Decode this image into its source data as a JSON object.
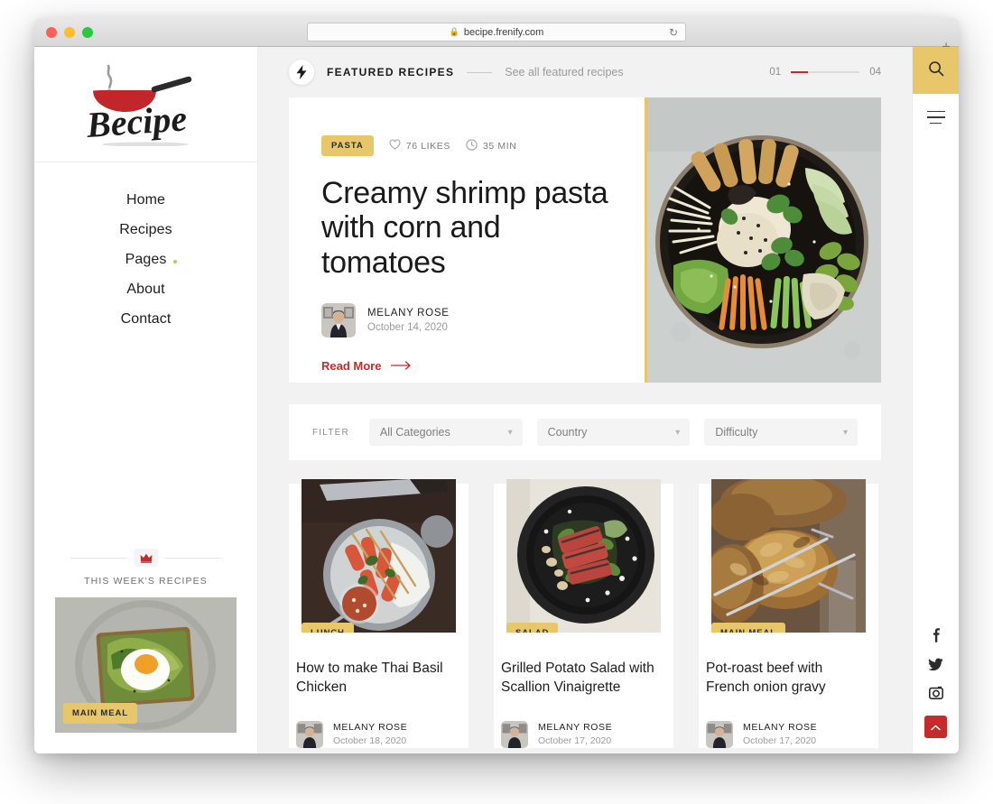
{
  "browser": {
    "url": "becipe.frenify.com",
    "lock_icon": "lock-icon",
    "reload_icon": "reload-icon",
    "newtab_label": "+"
  },
  "sidebar": {
    "logo_text": "Becipe",
    "nav": [
      {
        "label": "Home",
        "has_dot": false
      },
      {
        "label": "Recipes",
        "has_dot": false
      },
      {
        "label": "Pages",
        "has_dot": true
      },
      {
        "label": "About",
        "has_dot": false
      },
      {
        "label": "Contact",
        "has_dot": false
      }
    ],
    "week": {
      "crown_icon": "crown-icon",
      "title": "THIS WEEK'S RECIPES",
      "badge": "MAIN MEAL"
    }
  },
  "section": {
    "bolt_icon": "bolt-icon",
    "title": "FEATURED RECIPES",
    "link": "See all featured recipes",
    "slider_current": "01",
    "slider_total": "04",
    "slider_progress_pct": 25
  },
  "hero": {
    "category": "PASTA",
    "likes": "76 LIKES",
    "likes_icon": "heart-icon",
    "time": "35 MIN",
    "time_icon": "clock-icon",
    "title": "Creamy shrimp pasta with corn and tomatoes",
    "author": "MELANY ROSE",
    "date": "October 14, 2020",
    "read_more": "Read More",
    "read_more_icon": "arrow-right-icon"
  },
  "filter": {
    "label": "FILTER",
    "selects": [
      {
        "value": "All Categories",
        "icon": "chevron-down-icon"
      },
      {
        "value": "Country",
        "icon": "chevron-down-icon"
      },
      {
        "value": "Difficulty",
        "icon": "chevron-down-icon"
      }
    ]
  },
  "cards": [
    {
      "badge": "LUNCH",
      "title": "How to make Thai Basil Chicken",
      "author": "MELANY ROSE",
      "date": "October 18, 2020"
    },
    {
      "badge": "SALAD",
      "title": "Grilled Potato Salad with Scallion Vinaigrette",
      "author": "MELANY ROSE",
      "date": "October 17, 2020"
    },
    {
      "badge": "MAIN MEAL",
      "title": "Pot-roast beef with French onion gravy",
      "author": "MELANY ROSE",
      "date": "October 17, 2020"
    }
  ],
  "rail": {
    "search_icon": "search-icon",
    "menu_icon": "hamburger-menu-icon",
    "socials": [
      {
        "icon": "facebook-icon"
      },
      {
        "icon": "twitter-icon"
      },
      {
        "icon": "instagram-icon"
      }
    ],
    "to_top_icon": "chevron-up-icon"
  },
  "colors": {
    "gold": "#e8c76a",
    "red": "#c62b2b",
    "page_bg": "#f2f2f2"
  }
}
